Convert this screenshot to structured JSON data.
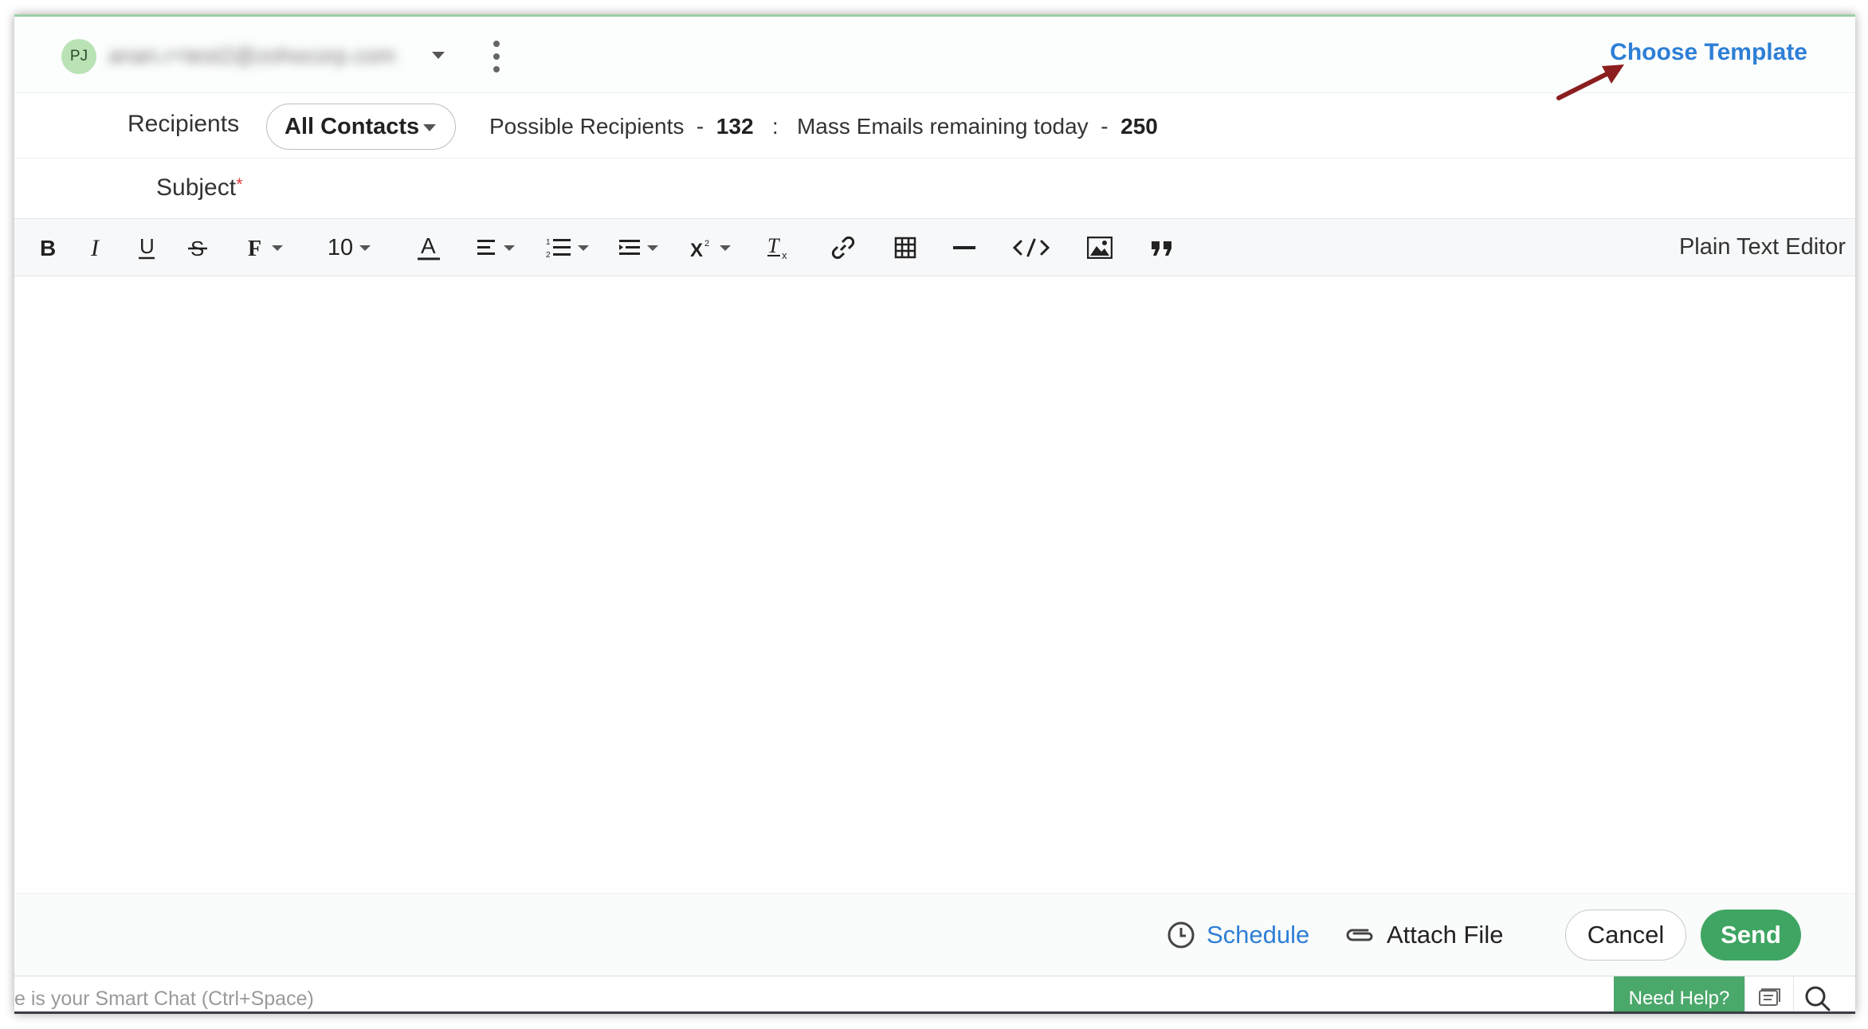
{
  "colors": {
    "accent_link": "#2d7fd6",
    "send_green": "#3fa562",
    "need_help_green": "#4aa86b",
    "avatar_bg": "#b9e3b5",
    "required_red": "#e23c3c",
    "annotation_arrow": "#8b1e1e"
  },
  "header": {
    "avatar_initials": "PJ",
    "from_email": "anan.r+test2@zohocorp.com",
    "choose_template": "Choose Template",
    "icons": [
      "chevron-down-icon",
      "kebab-menu-icon",
      "annotation-arrow-icon"
    ]
  },
  "recipients": {
    "label": "Recipients",
    "selected": "All Contacts",
    "possible_label": "Possible Recipients",
    "possible_sep": "-",
    "possible_count": "132",
    "separator": ":",
    "mass_label": "Mass Emails remaining today",
    "mass_sep": "-",
    "mass_count": "250"
  },
  "subject": {
    "label": "Subject",
    "required_mark": "*",
    "value": ""
  },
  "toolbar": {
    "font_size": "10",
    "plain_text_editor": "Plain Text Editor",
    "icons": [
      "bold-icon",
      "italic-icon",
      "underline-icon",
      "strikethrough-icon",
      "font-family-icon",
      "font-size-select",
      "text-color-icon",
      "align-icon",
      "numbered-list-icon",
      "indent-icon",
      "superscript-icon",
      "clear-format-icon",
      "link-icon",
      "table-icon",
      "horizontal-rule-icon",
      "code-icon",
      "image-icon",
      "blockquote-icon"
    ]
  },
  "footer": {
    "schedule": "Schedule",
    "attach_file": "Attach File",
    "cancel": "Cancel",
    "send": "Send"
  },
  "bottombar": {
    "smart_chat_placeholder": "e is your Smart Chat (Ctrl+Space)",
    "need_help": "Need Help?",
    "icons": [
      "chat-icon",
      "search-icon"
    ]
  }
}
